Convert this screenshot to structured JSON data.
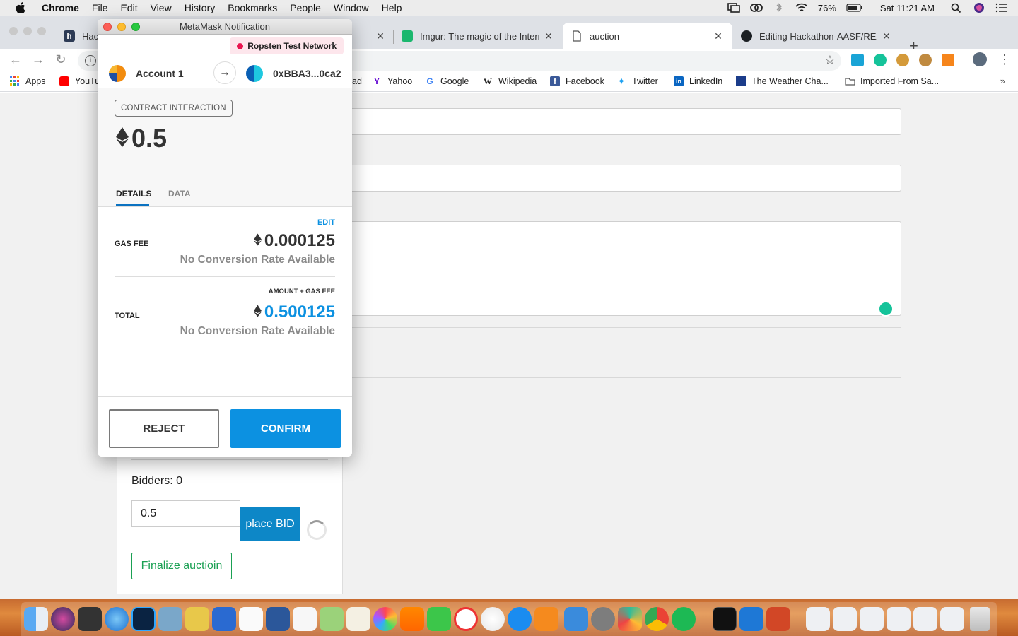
{
  "menubar": {
    "app": "Chrome",
    "items": [
      "File",
      "Edit",
      "View",
      "History",
      "Bookmarks",
      "People",
      "Window",
      "Help"
    ],
    "battery": "76%",
    "clock": "Sat 11:21 AM"
  },
  "tabs": [
    {
      "title": "Hack",
      "active": false
    },
    {
      "title": "Imgur: The magic of the Internet",
      "active": false
    },
    {
      "title": "auction",
      "active": true
    },
    {
      "title": "Editing Hackathon-AASF/README",
      "active": false
    }
  ],
  "bookmarks": [
    "Apps",
    "YouTu",
    "ad",
    "Yahoo",
    "Google",
    "Wikipedia",
    "Facebook",
    "Twitter",
    "LinkedIn",
    "The Weather Cha...",
    "Imported From Sa..."
  ],
  "page": {
    "bidders": "Bidders: 0",
    "bid_value": "0.5",
    "place_bid": "place BID",
    "finalize": "Finalize auctioin"
  },
  "metamask": {
    "window_title": "MetaMask Notification",
    "network": "Ropsten Test Network",
    "from_account": "Account 1",
    "to_account": "0xBBA3...0ca2",
    "interaction_label": "CONTRACT INTERACTION",
    "amount": "0.5",
    "tab_details": "DETAILS",
    "tab_data": "DATA",
    "edit": "EDIT",
    "gas_fee_label": "GAS FEE",
    "gas_fee_value": "0.000125",
    "no_conversion": "No Conversion Rate Available",
    "amount_gas_label": "AMOUNT + GAS FEE",
    "total_label": "TOTAL",
    "total_value": "0.500125",
    "reject": "REJECT",
    "confirm": "CONFIRM"
  },
  "colors": {
    "accent_blue": "#0c91e1",
    "network_dot": "#e91550",
    "finalize_green": "#1aa053",
    "bid_button": "#0d87c7"
  }
}
